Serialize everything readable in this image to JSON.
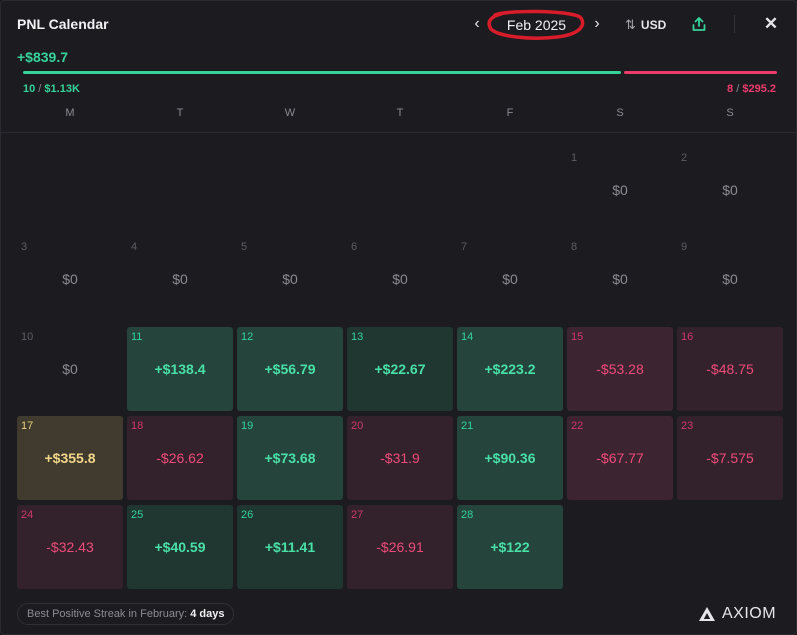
{
  "header": {
    "title": "PNL Calendar",
    "month": "Feb 2025",
    "currency": "USD",
    "annotation_color": "#d81c2a"
  },
  "summary": {
    "total": "+$839.7",
    "wins": {
      "count": "10",
      "amount": "$1.13K"
    },
    "losses": {
      "count": "8",
      "amount": "$295.2"
    },
    "win_share": 0.793,
    "colors": {
      "positive": "#35d39a",
      "negative": "#ec3b6c",
      "best": "#f2d78a"
    }
  },
  "weekdays": [
    "M",
    "T",
    "W",
    "T",
    "F",
    "S",
    "S"
  ],
  "days": [
    {
      "day": "1",
      "pnl": "$0",
      "type": "zero"
    },
    {
      "day": "2",
      "pnl": "$0",
      "type": "zero"
    },
    {
      "day": "3",
      "pnl": "$0",
      "type": "zero"
    },
    {
      "day": "4",
      "pnl": "$0",
      "type": "zero"
    },
    {
      "day": "5",
      "pnl": "$0",
      "type": "zero"
    },
    {
      "day": "6",
      "pnl": "$0",
      "type": "zero"
    },
    {
      "day": "7",
      "pnl": "$0",
      "type": "zero"
    },
    {
      "day": "8",
      "pnl": "$0",
      "type": "zero"
    },
    {
      "day": "9",
      "pnl": "$0",
      "type": "zero"
    },
    {
      "day": "10",
      "pnl": "$0",
      "type": "zero"
    },
    {
      "day": "11",
      "pnl": "+$138.4",
      "type": "pos"
    },
    {
      "day": "12",
      "pnl": "+$56.79",
      "type": "pos"
    },
    {
      "day": "13",
      "pnl": "+$22.67",
      "type": "pos"
    },
    {
      "day": "14",
      "pnl": "+$223.2",
      "type": "pos"
    },
    {
      "day": "15",
      "pnl": "-$53.28",
      "type": "neg"
    },
    {
      "day": "16",
      "pnl": "-$48.75",
      "type": "neg"
    },
    {
      "day": "17",
      "pnl": "+$355.8",
      "type": "best"
    },
    {
      "day": "18",
      "pnl": "-$26.62",
      "type": "neg"
    },
    {
      "day": "19",
      "pnl": "+$73.68",
      "type": "pos"
    },
    {
      "day": "20",
      "pnl": "-$31.9",
      "type": "neg"
    },
    {
      "day": "21",
      "pnl": "+$90.36",
      "type": "pos"
    },
    {
      "day": "22",
      "pnl": "-$67.77",
      "type": "neg"
    },
    {
      "day": "23",
      "pnl": "-$7.575",
      "type": "neg"
    },
    {
      "day": "24",
      "pnl": "-$32.43",
      "type": "neg"
    },
    {
      "day": "25",
      "pnl": "+$40.59",
      "type": "pos"
    },
    {
      "day": "26",
      "pnl": "+$11.41",
      "type": "pos"
    },
    {
      "day": "27",
      "pnl": "-$26.91",
      "type": "neg"
    },
    {
      "day": "28",
      "pnl": "+$122",
      "type": "pos"
    }
  ],
  "footer": {
    "streak_label": "Best Positive Streak in February:",
    "streak_value": "4 days",
    "brand": "AXIOM"
  },
  "icons": [
    "chevron-left-icon",
    "chevron-right-icon",
    "swap-icon",
    "share-icon",
    "close-icon",
    "axiom-logo-icon"
  ]
}
